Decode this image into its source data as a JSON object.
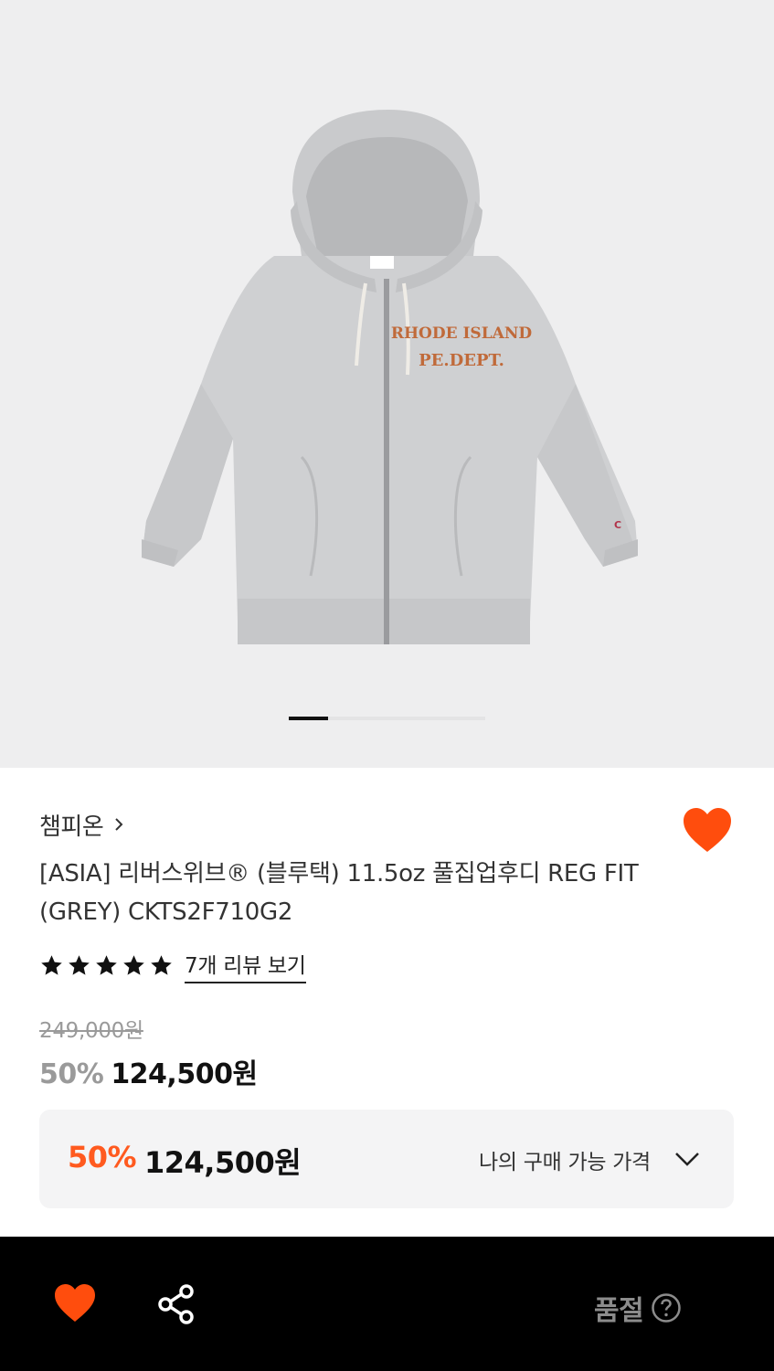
{
  "gallery": {
    "image_alt": "grey full zip hoodie",
    "print_line1": "RHODE ISLAND",
    "print_line2": "PE.DEPT.",
    "pager_pages": 5,
    "pager_active_index": 0
  },
  "product": {
    "brand": "챔피온",
    "title": "[ASIA] 리버스위브® (블루택) 11.5oz 풀집업후디 REG FIT (GREY) CKTS2F710G2",
    "rating": 5,
    "review_link": "7개 리뷰 보기",
    "original_price": "249,000원",
    "discount": "50%",
    "sale_price": "124,500원"
  },
  "my_price": {
    "discount": "50%",
    "price": "124,500원",
    "label": "나의 구매 가능 가격"
  },
  "bottom_bar": {
    "status": "품절"
  },
  "colors": {
    "accent": "#ff5a1f",
    "gallery_bg": "#eeeeef",
    "bar_bg": "#000000",
    "muted": "#9a9a9a"
  },
  "icons": {
    "wishlist": "heart-icon",
    "share": "share-icon",
    "help": "question-circle-icon",
    "brand_link": "chevron-right-icon",
    "dropdown": "chevron-down-icon"
  }
}
